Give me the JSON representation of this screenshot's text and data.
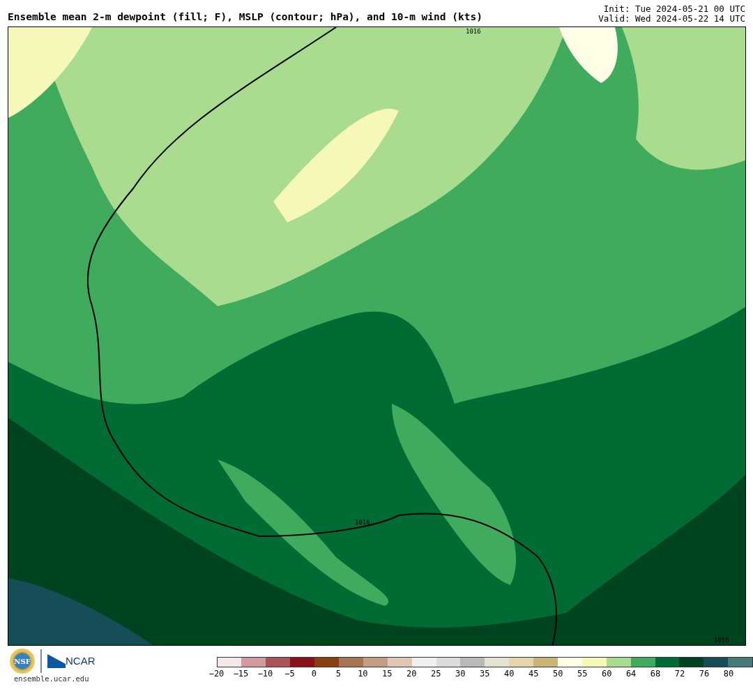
{
  "title": "Ensemble mean 2-m dewpoint (fill; F), MSLP (contour; hPa), and 10-m wind (kts)",
  "init": "Init: Tue 2024-05-21 00 UTC",
  "valid": "Valid: Wed 2024-05-22 14 UTC",
  "map": {
    "contour_labels": [
      "1016",
      "1016",
      "1016"
    ]
  },
  "footer": {
    "nsf_logo": "NSF",
    "ncar_logo": "NCAR",
    "url": "ensemble.ucar.edu"
  },
  "colorbar": {
    "swatches": [
      {
        "color": "#f5e8e8"
      },
      {
        "color": "#d09a9f"
      },
      {
        "color": "#a9535a"
      },
      {
        "color": "#8b1119"
      },
      {
        "color": "#8a3f0e"
      },
      {
        "color": "#a87452"
      },
      {
        "color": "#c39d84"
      },
      {
        "color": "#e0c6b4"
      },
      {
        "color": "#f0f0f0"
      },
      {
        "color": "#dcdcdc"
      },
      {
        "color": "#b9b9b9"
      },
      {
        "color": "#e4e2d2"
      },
      {
        "color": "#e5d5aa"
      },
      {
        "color": "#cbb478"
      },
      {
        "color": "#fefde6"
      },
      {
        "color": "#f6f8ba"
      },
      {
        "color": "#a9dc8e"
      },
      {
        "color": "#41ab5d"
      },
      {
        "color": "#006b33"
      },
      {
        "color": "#00441f"
      },
      {
        "color": "#164d56"
      },
      {
        "color": "#47787a"
      }
    ],
    "ticks": [
      "−20",
      "−15",
      "−10",
      "−5",
      "0",
      "5",
      "10",
      "15",
      "20",
      "25",
      "30",
      "35",
      "40",
      "45",
      "50",
      "55",
      "60",
      "64",
      "68",
      "72",
      "76",
      "80"
    ]
  }
}
